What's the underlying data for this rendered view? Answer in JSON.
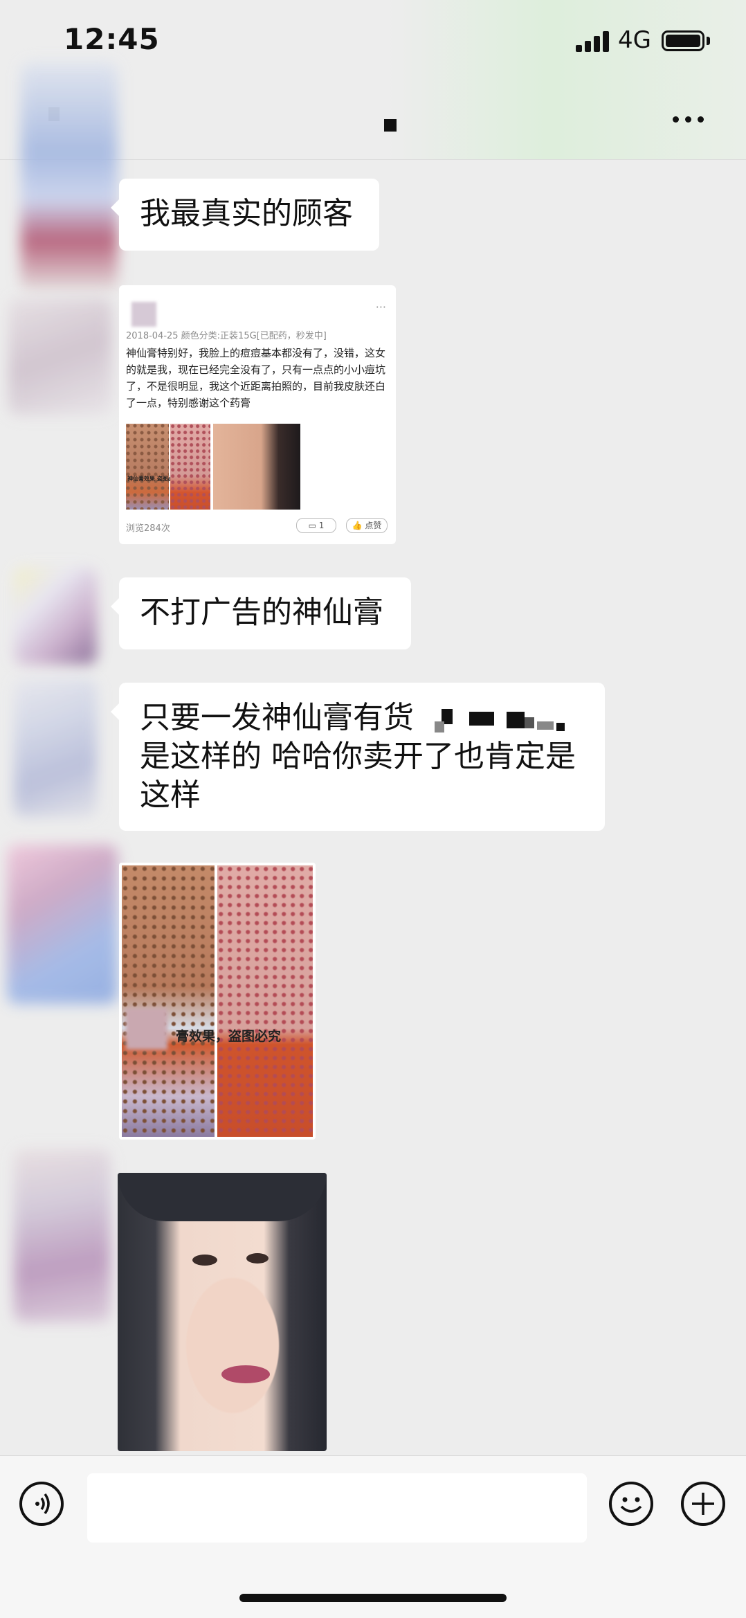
{
  "status_bar": {
    "time": "12:45",
    "network": "4G"
  },
  "messages": {
    "m1": "我最真实的顾客",
    "m3": "不打广告的神仙膏",
    "m4": {
      "line1": "只要一发神仙膏有货",
      "line2": "是这样的 哈哈你卖开了也肯定是",
      "line3": "这样"
    }
  },
  "review_card": {
    "date_line": "2018-04-25  颜色分类:正装15G[已配药，秒发中]",
    "body": "神仙膏特别好，我脸上的痘痘基本都没有了，没错，这女的就是我，现在已经完全没有了，只有一点点的小小痘坑了，不是很明显，我这个近距离拍照的，目前我皮肤还白了一点，特别感谢这个药膏",
    "views": "浏览284次",
    "comment_count": "1",
    "like_label": "点赞",
    "photo_watermark": "神仙膏效果  盗图必究"
  },
  "photo_watermark": "膏效果，盗图必究",
  "colors": {
    "background": "#ededed",
    "bubble": "#ffffff",
    "text": "#111111"
  }
}
